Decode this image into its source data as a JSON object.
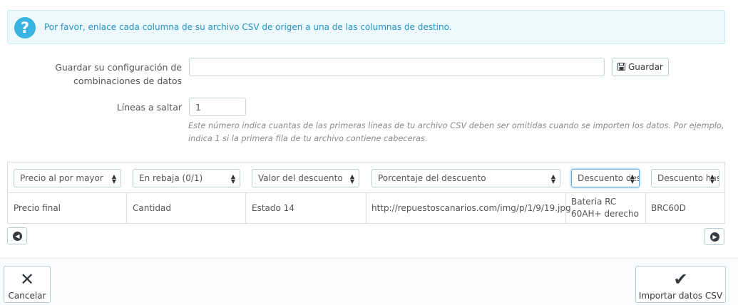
{
  "alert": {
    "icon": "question-icon",
    "text": "Por favor, enlace cada columna de su archivo CSV de origen a una de las columnas de destino."
  },
  "form": {
    "save_config_label_line1": "Guardar su configuración de",
    "save_config_label_line2": "combinaciones de datos",
    "save_config_value": "",
    "save_button_label": "Guardar",
    "skip_label": "Líneas a saltar",
    "skip_value": "1",
    "skip_help": "Este número indica cuantas de las primeras líneas de tu archivo CSV deben ser omitidas cuando se importen los datos. Por ejemplo, indica 1 si la primera fila de tu archivo contiene cabeceras."
  },
  "table": {
    "columns": [
      {
        "select": "Precio al por mayor",
        "value_line1": "Precio final",
        "value_line2": ""
      },
      {
        "select": "En rebaja (0/1)",
        "value_line1": "Cantidad",
        "value_line2": ""
      },
      {
        "select": "Valor del descuento",
        "value_line1": "Estado 14",
        "value_line2": ""
      },
      {
        "select": "Porcentaje del descuento",
        "value_line1": "http://repuestoscanarios.com/img/p/1/9/19.jpg",
        "value_line2": ""
      },
      {
        "select": "Descuento desde (aaaa-mm-dd)",
        "value_line1": "Bateria RC",
        "value_line2": "60AH+ derecho"
      },
      {
        "select": "Descuento hasta (aaaa-mm-dd)",
        "value_line1": "BRC60D",
        "value_line2": ""
      }
    ]
  },
  "footer": {
    "cancel_label": "Cancelar",
    "import_label": "Importar datos CSV"
  }
}
